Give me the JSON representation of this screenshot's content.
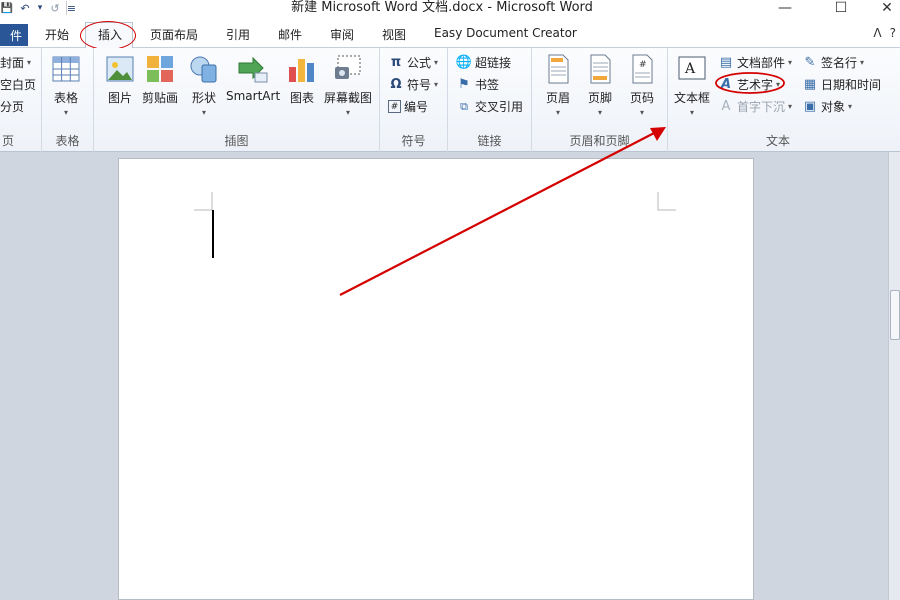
{
  "window": {
    "title": "新建 Microsoft Word 文档.docx - Microsoft Word",
    "minimize": "—",
    "maximize": "☐",
    "close": "✕"
  },
  "qat": {
    "save": "💾",
    "undo": "↶",
    "undo_dd": "▾",
    "redo": "↺",
    "customize": "≡"
  },
  "tabs": {
    "file": "件",
    "home": "开始",
    "insert": "插入",
    "layout": "页面布局",
    "references": "引用",
    "mailings": "邮件",
    "review": "审阅",
    "view": "视图",
    "addin": "Easy Document Creator"
  },
  "help_icons": {
    "collapse": "ᐱ",
    "help": "?"
  },
  "ribbon": {
    "pages": {
      "label": "页",
      "items": [
        "封面",
        "空白页",
        "分页"
      ]
    },
    "tables": {
      "label": "表格",
      "button": "表格"
    },
    "illustrations": {
      "label": "插图",
      "buttons": [
        "图片",
        "剪贴画",
        "形状",
        "SmartArt",
        "图表",
        "屏幕截图"
      ]
    },
    "symbols": {
      "label": "符号",
      "items": [
        "公式",
        "符号",
        "编号"
      ]
    },
    "links": {
      "label": "链接",
      "items": [
        "超链接",
        "书签",
        "交叉引用"
      ]
    },
    "header_footer": {
      "label": "页眉和页脚",
      "buttons": [
        "页眉",
        "页脚",
        "页码"
      ]
    },
    "text": {
      "label": "文本",
      "textbox": "文本框",
      "items_left": [
        "文档部件",
        "艺术字",
        "首字下沉"
      ],
      "items_right": [
        "签名行",
        "日期和时间",
        "对象"
      ]
    }
  },
  "accent": {
    "file_tab": "#2a5597",
    "annotation": "#d40000"
  }
}
